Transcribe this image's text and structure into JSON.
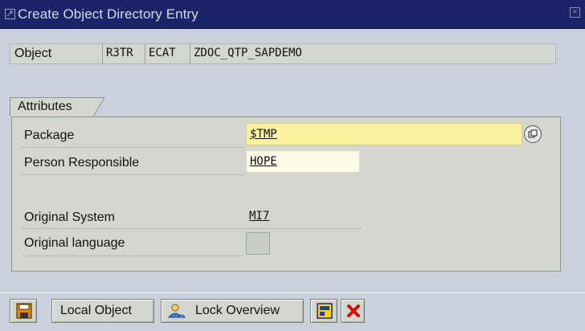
{
  "window": {
    "title": "Create Object Directory Entry",
    "close_symbol": "×"
  },
  "object": {
    "label": "Object",
    "pgmid": "R3TR",
    "type": "ECAT",
    "name": "ZDOC_QTP_SAPDEMO"
  },
  "attributes": {
    "group_title": "Attributes",
    "package_label": "Package",
    "package_value": "$TMP",
    "person_label": "Person Responsible",
    "person_value": "HOPE",
    "system_label": "Original System",
    "system_value": "MI7",
    "language_label": "Original language",
    "language_value": ""
  },
  "toolbar": {
    "local_object_label": "Local Object",
    "lock_overview_label": "Lock Overview"
  },
  "icons": {
    "save": "save-icon",
    "f4_help": "value-help-icon",
    "lock_overview": "users-icon",
    "display": "display-icon",
    "cancel": "cancel-icon"
  },
  "colors": {
    "titlebar": "#1a2466",
    "background": "#c9d2dc",
    "required_field": "#fbf1a1",
    "input_field": "#fdfbe6",
    "cancel_red": "#d01010",
    "save_orange": "#e08a00"
  }
}
